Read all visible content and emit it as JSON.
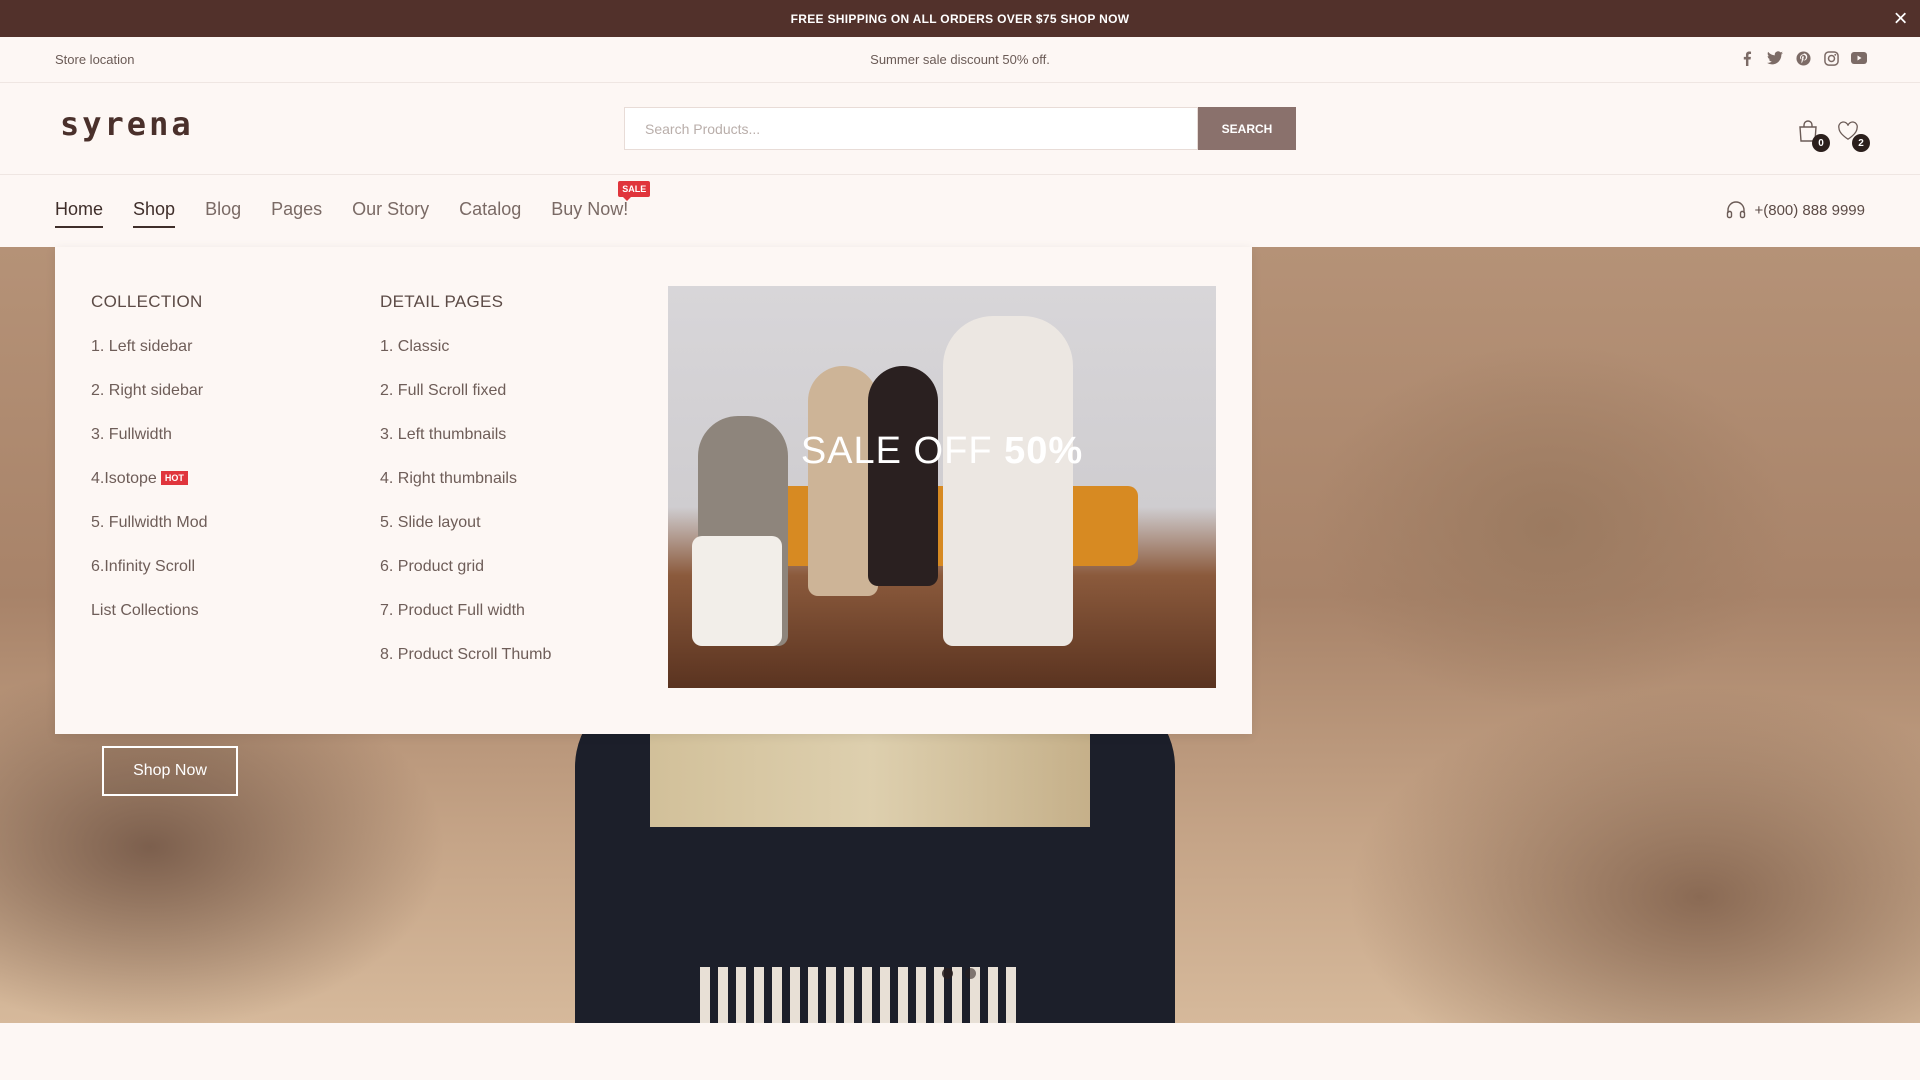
{
  "announcement": {
    "text": "FREE SHIPPING ON ALL ORDERS OVER $75 SHOP NOW",
    "close": "×"
  },
  "infobar": {
    "store_location": "Store location",
    "promo": "Summer sale discount 50% off.",
    "social": [
      "facebook-icon",
      "twitter-icon",
      "pinterest-icon",
      "instagram-icon",
      "youtube-icon"
    ]
  },
  "header": {
    "logo": "syrena",
    "search_placeholder": "Search Products...",
    "search_button": "SEARCH",
    "cart_count": "0",
    "wishlist_count": "2"
  },
  "nav": {
    "items": [
      "Home",
      "Shop",
      "Blog",
      "Pages",
      "Our Story",
      "Catalog",
      "Buy Now!"
    ],
    "active": [
      "Home",
      "Shop"
    ],
    "sale_badge": "SALE",
    "phone": "+(800) 888 9999"
  },
  "mega_menu": {
    "collection": {
      "title": "COLLECTION",
      "items": [
        "1. Left sidebar",
        "2. Right sidebar",
        "3. Fullwidth",
        "4.Isotope",
        "5. Fullwidth Mod",
        "6.Infinity Scroll",
        "List Collections"
      ],
      "hot_badge": "HOT"
    },
    "detail_pages": {
      "title": "DETAIL PAGES",
      "items": [
        "1. Classic",
        "2. Full Scroll fixed",
        "3. Left thumbnails",
        "4. Right thumbnails",
        "5. Slide layout",
        "6. Product grid",
        "7. Product Full width",
        "8. Product Scroll Thumb"
      ]
    },
    "promo": {
      "light": "SALE OFF ",
      "bold": "50%"
    }
  },
  "hero": {
    "button": "Shop Now",
    "slides": 2,
    "active_slide": 1
  },
  "colors": {
    "topbar": "#52312b",
    "accent": "#8a716c",
    "badge": "#e0353c",
    "background": "#fdf7f4"
  }
}
